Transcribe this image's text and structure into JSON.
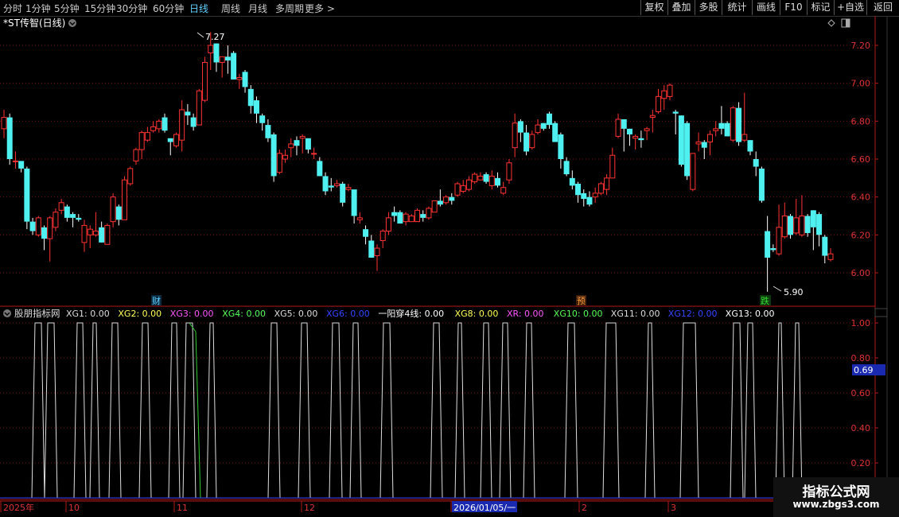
{
  "toolbar": {
    "left_items": [
      "分时",
      "1分钟",
      "5分钟",
      "15分钟",
      "30分钟",
      "60分钟",
      "日线",
      "周线",
      "月线",
      "多周期",
      "更多 >"
    ],
    "active_index": 6,
    "right_items": [
      "复权",
      "叠加",
      "多股",
      "统计",
      "画线",
      "F10",
      "标记",
      "+自选",
      "返回"
    ]
  },
  "main_panel": {
    "title": "*ST传智(日线)",
    "high_label": "7.27",
    "low_label": "5.90",
    "markers": [
      {
        "text": "财",
        "color": "#5fd0ff"
      },
      {
        "text": "预",
        "color": "#ff9a3c"
      },
      {
        "text": "跌",
        "color": "#33dd33"
      }
    ],
    "y_ticks": [
      "7.20",
      "7.00",
      "6.80",
      "6.60",
      "6.40",
      "6.20",
      "6.00"
    ]
  },
  "indicator_panel": {
    "name": "股朋指标网",
    "items": [
      {
        "label": "XG1: 0.00",
        "color": "#dddddd"
      },
      {
        "label": "XG2: 0.00",
        "color": "#ffff55"
      },
      {
        "label": "XG3: 0.00",
        "color": "#ff55ff"
      },
      {
        "label": "XG4: 0.00",
        "color": "#55ff55"
      },
      {
        "label": "XG5: 0.00",
        "color": "#dddddd"
      },
      {
        "label": "XG6: 0.00",
        "color": "#3344ff"
      },
      {
        "label": "一阳穿4线: 0.00",
        "color": "#ffffff"
      },
      {
        "label": "XG8: 0.00",
        "color": "#ffff55"
      },
      {
        "label": "XR: 0.00",
        "color": "#ff55ff"
      },
      {
        "label": "XG10: 0.00",
        "color": "#55ff55"
      },
      {
        "label": "XG11: 0.00",
        "color": "#dddddd"
      },
      {
        "label": "XG12: 0.00",
        "color": "#3344ff"
      },
      {
        "label": "XG13: 0.00",
        "color": "#ffffff"
      }
    ],
    "y_ticks": [
      "1.00",
      "0.80",
      "0.60",
      "0.40",
      "0.20"
    ],
    "cursor_value": "0.69"
  },
  "x_axis": {
    "labels": [
      "2025年",
      "10",
      "11",
      "12",
      "2026/01/05/一",
      "2",
      "3"
    ]
  },
  "watermark": {
    "title": "指标公式网",
    "url": "www.zbgs3.com"
  },
  "colors": {
    "up": "#ff3333",
    "down": "#4ff0f0",
    "axis": "#b01818",
    "grid": "#7a1010"
  },
  "chart_data": {
    "type": "candlestick",
    "ylim": [
      5.9,
      7.3
    ],
    "candles": [
      [
        6.76,
        6.82,
        6.86,
        6.71
      ],
      [
        6.82,
        6.6,
        6.84,
        6.57
      ],
      [
        6.59,
        6.59,
        6.64,
        6.55
      ],
      [
        6.59,
        6.55,
        6.58,
        6.53
      ],
      [
        6.55,
        6.27,
        6.56,
        6.23
      ],
      [
        6.27,
        6.22,
        6.29,
        6.2
      ],
      [
        6.2,
        6.29,
        6.3,
        6.19
      ],
      [
        6.24,
        6.18,
        6.25,
        6.12
      ],
      [
        6.18,
        6.29,
        6.3,
        6.06
      ],
      [
        6.24,
        6.32,
        6.34,
        6.22
      ],
      [
        6.33,
        6.37,
        6.39,
        6.31
      ],
      [
        6.35,
        6.29,
        6.36,
        6.27
      ],
      [
        6.31,
        6.29,
        6.32,
        6.24
      ],
      [
        6.29,
        6.28,
        6.31,
        6.27
      ],
      [
        6.16,
        6.25,
        6.28,
        6.11
      ],
      [
        6.2,
        6.23,
        6.25,
        6.13
      ],
      [
        6.2,
        6.22,
        6.32,
        6.19
      ],
      [
        6.24,
        6.16,
        6.27,
        6.16
      ],
      [
        6.15,
        6.25,
        6.26,
        6.15
      ],
      [
        6.27,
        6.4,
        6.42,
        6.24
      ],
      [
        6.35,
        6.28,
        6.36,
        6.25
      ],
      [
        6.28,
        6.49,
        6.51,
        6.28
      ],
      [
        6.47,
        6.55,
        6.56,
        6.46
      ],
      [
        6.59,
        6.65,
        6.66,
        6.57
      ],
      [
        6.65,
        6.74,
        6.75,
        6.6
      ],
      [
        6.7,
        6.74,
        6.77,
        6.69
      ],
      [
        6.75,
        6.77,
        6.8,
        6.74
      ],
      [
        6.76,
        6.8,
        6.81,
        6.74
      ],
      [
        6.82,
        6.75,
        6.84,
        6.74
      ],
      [
        6.71,
        6.69,
        6.7,
        6.62
      ],
      [
        6.67,
        6.73,
        6.74,
        6.66
      ],
      [
        6.7,
        6.86,
        6.91,
        6.64
      ],
      [
        6.85,
        6.83,
        6.89,
        6.78
      ],
      [
        6.82,
        6.77,
        6.84,
        6.75
      ],
      [
        6.78,
        6.96,
        6.97,
        6.78
      ],
      [
        6.91,
        7.11,
        7.14,
        6.9
      ],
      [
        7.16,
        7.2,
        7.27,
        7.07
      ],
      [
        7.21,
        7.11,
        7.21,
        7.06
      ],
      [
        7.11,
        7.14,
        7.14,
        7.03
      ],
      [
        7.14,
        7.12,
        7.2,
        7.05
      ],
      [
        7.16,
        7.02,
        7.17,
        7.02
      ],
      [
        7.02,
        7.03,
        7.05,
        6.97
      ],
      [
        7.06,
        6.98,
        7.07,
        6.95
      ],
      [
        6.97,
        6.88,
        6.99,
        6.84
      ],
      [
        6.91,
        6.84,
        6.93,
        6.79
      ],
      [
        6.83,
        6.79,
        6.84,
        6.75
      ],
      [
        6.78,
        6.71,
        6.81,
        6.69
      ],
      [
        6.73,
        6.51,
        6.74,
        6.48
      ],
      [
        6.53,
        6.63,
        6.65,
        6.52
      ],
      [
        6.6,
        6.62,
        6.65,
        6.58
      ],
      [
        6.66,
        6.68,
        6.71,
        6.61
      ],
      [
        6.7,
        6.67,
        6.72,
        6.62
      ],
      [
        6.71,
        6.72,
        6.73,
        6.63
      ],
      [
        6.71,
        6.65,
        6.7,
        6.63
      ],
      [
        6.63,
        6.63,
        6.66,
        6.6
      ],
      [
        6.59,
        6.51,
        6.61,
        6.51
      ],
      [
        6.51,
        6.43,
        6.53,
        6.41
      ],
      [
        6.46,
        6.45,
        6.5,
        6.43
      ],
      [
        6.46,
        6.47,
        6.49,
        6.45
      ],
      [
        6.47,
        6.37,
        6.48,
        6.35
      ],
      [
        6.44,
        6.45,
        6.47,
        6.43
      ],
      [
        6.44,
        6.3,
        6.43,
        6.26
      ],
      [
        6.28,
        6.29,
        6.32,
        6.26
      ],
      [
        6.23,
        6.19,
        6.25,
        6.15
      ],
      [
        6.17,
        6.08,
        6.2,
        6.08
      ],
      [
        6.09,
        6.13,
        6.15,
        6.01
      ],
      [
        6.17,
        6.22,
        6.23,
        6.13
      ],
      [
        6.22,
        6.29,
        6.32,
        6.2
      ],
      [
        6.32,
        6.3,
        6.35,
        6.27
      ],
      [
        6.32,
        6.26,
        6.33,
        6.26
      ],
      [
        6.27,
        6.31,
        6.32,
        6.25
      ],
      [
        6.27,
        6.3,
        6.31,
        6.27
      ],
      [
        6.27,
        6.33,
        6.34,
        6.27
      ],
      [
        6.31,
        6.29,
        6.33,
        6.27
      ],
      [
        6.29,
        6.34,
        6.35,
        6.28
      ],
      [
        6.32,
        6.38,
        6.38,
        6.32
      ],
      [
        6.38,
        6.36,
        6.44,
        6.35
      ],
      [
        6.37,
        6.4,
        6.41,
        6.36
      ],
      [
        6.4,
        6.38,
        6.42,
        6.36
      ],
      [
        6.41,
        6.47,
        6.48,
        6.4
      ],
      [
        6.43,
        6.46,
        6.49,
        6.42
      ],
      [
        6.44,
        6.49,
        6.51,
        6.43
      ],
      [
        6.48,
        6.52,
        6.53,
        6.47
      ],
      [
        6.49,
        6.51,
        6.53,
        6.49
      ],
      [
        6.52,
        6.48,
        6.53,
        6.47
      ],
      [
        6.46,
        6.51,
        6.54,
        6.44
      ],
      [
        6.5,
        6.46,
        6.53,
        6.45
      ],
      [
        6.42,
        6.45,
        6.48,
        6.41
      ],
      [
        6.49,
        6.58,
        6.6,
        6.47
      ],
      [
        6.66,
        6.79,
        6.84,
        6.61
      ],
      [
        6.8,
        6.74,
        6.81,
        6.69
      ],
      [
        6.74,
        6.64,
        6.78,
        6.62
      ],
      [
        6.66,
        6.73,
        6.75,
        6.65
      ],
      [
        6.74,
        6.78,
        6.81,
        6.73
      ],
      [
        6.79,
        6.76,
        6.79,
        6.75
      ],
      [
        6.84,
        6.78,
        6.85,
        6.76
      ],
      [
        6.79,
        6.69,
        6.8,
        6.69
      ],
      [
        6.73,
        6.6,
        6.74,
        6.55
      ],
      [
        6.59,
        6.52,
        6.61,
        6.51
      ],
      [
        6.5,
        6.46,
        6.54,
        6.44
      ],
      [
        6.47,
        6.41,
        6.48,
        6.37
      ],
      [
        6.42,
        6.39,
        6.44,
        6.35
      ],
      [
        6.4,
        6.36,
        6.43,
        6.35
      ],
      [
        6.4,
        6.42,
        6.45,
        6.37
      ],
      [
        6.42,
        6.47,
        6.48,
        6.41
      ],
      [
        6.44,
        6.5,
        6.52,
        6.41
      ],
      [
        6.5,
        6.62,
        6.66,
        6.5
      ],
      [
        6.72,
        6.81,
        6.84,
        6.71
      ],
      [
        6.81,
        6.76,
        6.81,
        6.64
      ],
      [
        6.76,
        6.73,
        6.76,
        6.67
      ],
      [
        6.71,
        6.72,
        6.73,
        6.65
      ],
      [
        6.71,
        6.7,
        6.75,
        6.66
      ],
      [
        6.75,
        6.76,
        6.77,
        6.7
      ],
      [
        6.82,
        6.83,
        6.86,
        6.74
      ],
      [
        6.85,
        6.93,
        6.97,
        6.84
      ],
      [
        6.92,
        6.96,
        6.99,
        6.86
      ],
      [
        6.93,
        6.99,
        7.0,
        6.91
      ],
      [
        6.85,
        6.84,
        6.86,
        6.73
      ],
      [
        6.83,
        6.57,
        6.83,
        6.56
      ],
      [
        6.79,
        6.51,
        6.8,
        6.49
      ],
      [
        6.44,
        6.63,
        6.63,
        6.43
      ],
      [
        6.68,
        6.69,
        6.74,
        6.64
      ],
      [
        6.69,
        6.66,
        6.7,
        6.6
      ],
      [
        6.69,
        6.73,
        6.75,
        6.62
      ],
      [
        6.75,
        6.76,
        6.8,
        6.72
      ],
      [
        6.79,
        6.76,
        6.88,
        6.73
      ],
      [
        6.79,
        6.72,
        6.8,
        6.72
      ],
      [
        6.7,
        6.87,
        6.88,
        6.69
      ],
      [
        6.87,
        6.69,
        6.9,
        6.67
      ],
      [
        6.7,
        6.73,
        6.95,
        6.69
      ],
      [
        6.7,
        6.64,
        6.7,
        6.62
      ],
      [
        6.6,
        6.56,
        6.64,
        6.51
      ],
      [
        6.55,
        6.38,
        6.56,
        6.37
      ],
      [
        6.22,
        6.08,
        6.3,
        5.9
      ],
      [
        6.13,
        6.12,
        6.15,
        6.11
      ],
      [
        6.1,
        6.24,
        6.36,
        6.09
      ],
      [
        6.19,
        6.3,
        6.37,
        6.18
      ],
      [
        6.3,
        6.2,
        6.31,
        6.18
      ],
      [
        6.21,
        6.29,
        6.39,
        6.2
      ],
      [
        6.2,
        6.3,
        6.41,
        6.19
      ],
      [
        6.3,
        6.21,
        6.31,
        6.19
      ],
      [
        6.33,
        6.24,
        6.33,
        6.12
      ],
      [
        6.31,
        6.2,
        6.32,
        6.14
      ],
      [
        6.19,
        6.09,
        6.2,
        6.05
      ],
      [
        6.07,
        6.1,
        6.13,
        6.06
      ]
    ]
  }
}
